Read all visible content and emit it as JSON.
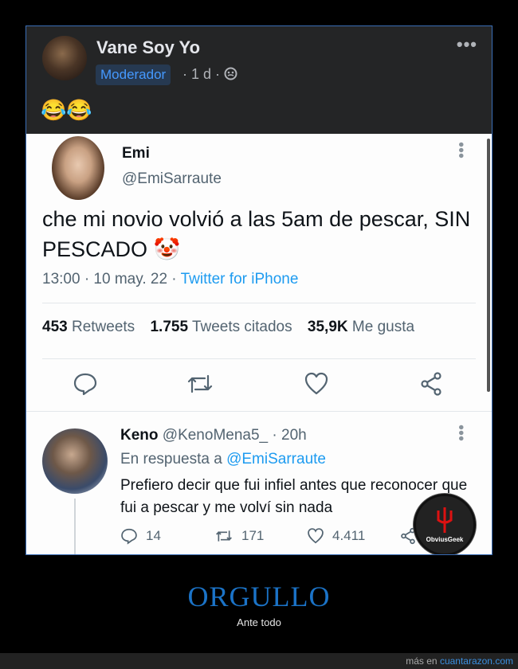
{
  "post": {
    "author": "Vane Soy Yo",
    "badge": "Moderador",
    "time": "· 1 d ·",
    "more": "•••",
    "emoji": "😂😂"
  },
  "tweet": {
    "name": "Emi",
    "handle": "@EmiSarraute",
    "text": "che mi novio volvió a las 5am de pescar, SIN PESCADO 🤡",
    "time": "13:00 · 10 may. 22 · ",
    "source": "Twitter for iPhone",
    "stats": {
      "retweets_count": "453",
      "retweets_label": "Retweets",
      "quotes_count": "1.755",
      "quotes_label": "Tweets citados",
      "likes_count": "35,9K",
      "likes_label": "Me gusta"
    }
  },
  "reply": {
    "name": "Keno",
    "handle": "@KenoMena5_",
    "time": "· 20h",
    "in_reply_prefix": "En respuesta a",
    "in_reply_mention": "@EmiSarraute",
    "text": "Prefiero decir que fui infiel antes que reconocer que fui a pescar y me volví sin nada",
    "replies": "14",
    "retweets": "171",
    "likes": "4.411"
  },
  "watermark": "ObviusGeek",
  "caption": {
    "title": "ORGULLO",
    "subtitle": "Ante todo"
  },
  "footer": {
    "prefix": "más en",
    "site": "cuantarazon.com"
  }
}
